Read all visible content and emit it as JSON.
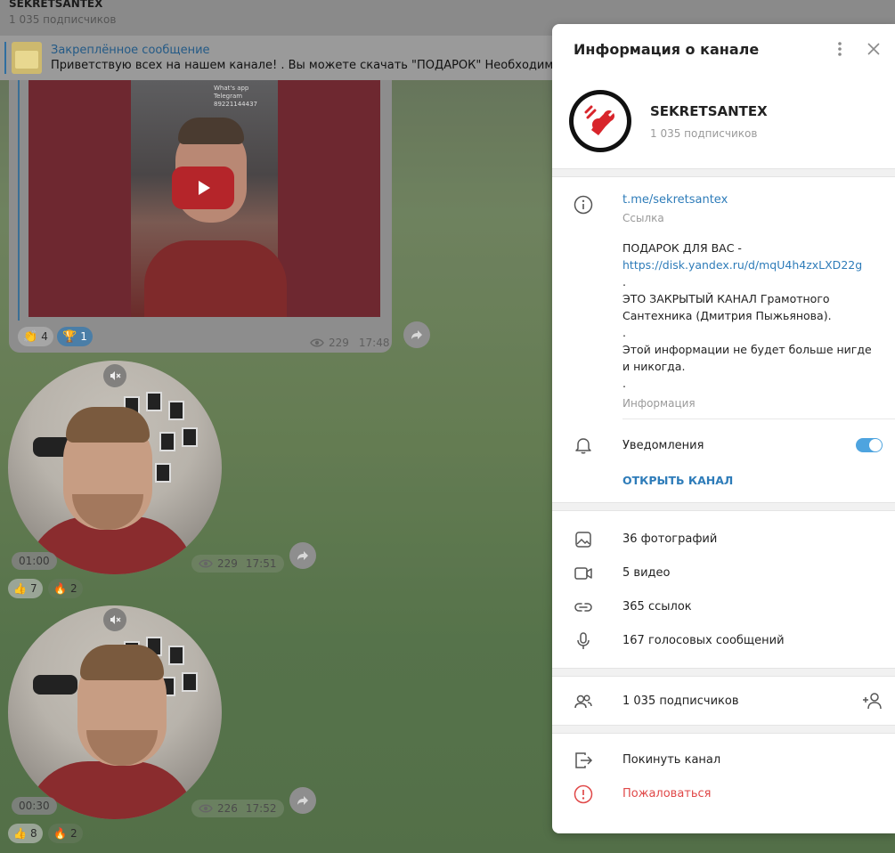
{
  "chat": {
    "title": "SEKRETSANTEX",
    "subscribers": "1 035 подписчиков",
    "pinned_title": "Закреплённое сообщение",
    "pinned_text": "Приветствую всех на нашем канале!  .  Вы можете скачать \"ПОДАРОК\" Необходимая база д",
    "video_overlay_text": "What's app Telegram 89221144437",
    "video_message": {
      "reactions": [
        {
          "emoji": "👏",
          "count": "4"
        },
        {
          "emoji": "🏆",
          "count": "1"
        }
      ],
      "views": "229",
      "time": "17:48"
    },
    "round_videos": [
      {
        "duration": "01:00",
        "views": "229",
        "time": "17:51",
        "reactions": [
          {
            "emoji": "👍",
            "count": "7"
          },
          {
            "emoji": "🔥",
            "count": "2"
          }
        ]
      },
      {
        "duration": "00:30",
        "views": "226",
        "time": "17:52",
        "reactions": [
          {
            "emoji": "👍",
            "count": "8"
          },
          {
            "emoji": "🔥",
            "count": "2"
          }
        ]
      }
    ]
  },
  "panel": {
    "title": "Информация о канале",
    "channel_name": "SEKRETSANTEX",
    "channel_subs": "1 035 подписчиков",
    "link": "t.me/sekretsantex",
    "link_label": "Ссылка",
    "desc_line1": "ПОДАРОК ДЛЯ ВАС -",
    "desc_url": "https://disk.yandex.ru/d/mqU4h4zxLXD22g",
    "desc_dot1": ".",
    "desc_line2": "ЭТО ЗАКРЫТЫЙ КАНАЛ Грамотного Сантехника (Дмитрия Пыжьянова).",
    "desc_dot2": ".",
    "desc_line3": "Этой информации не будет больше нигде и никогда.",
    "desc_dot3": ".",
    "info_label": "Информация",
    "notifications": "Уведомления",
    "notifications_on": true,
    "open_channel": "ОТКРЫТЬ КАНАЛ",
    "media": {
      "photos": "36 фотографий",
      "videos": "5 видео",
      "links": "365 ссылок",
      "voice": "167 голосовых сообщений"
    },
    "members": "1 035 подписчиков",
    "leave": "Покинуть канал",
    "report": "Пожаловаться"
  },
  "colors": {
    "accent": "#2e7cb9",
    "toggle": "#4ea4df",
    "danger": "#e04848"
  },
  "icons": [
    "more-vertical-icon",
    "close-icon",
    "info-icon",
    "bell-icon",
    "photo-icon",
    "video-icon",
    "link-icon",
    "mic-icon",
    "members-icon",
    "add-member-icon",
    "leave-icon",
    "report-icon",
    "mute-icon",
    "share-icon",
    "eye-icon",
    "play-icon"
  ]
}
